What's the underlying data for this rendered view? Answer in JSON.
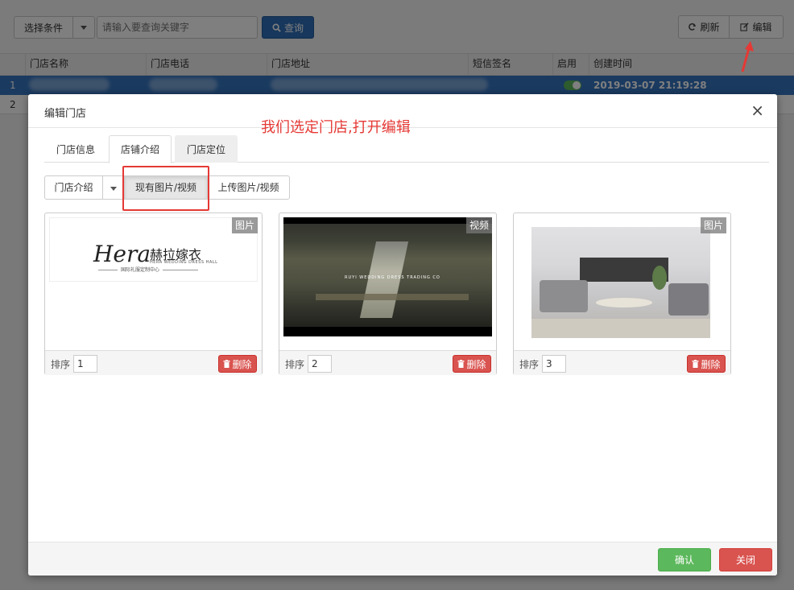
{
  "toolbar": {
    "condition_label": "选择条件",
    "search_placeholder": "请输入要查询关键字",
    "query_label": "查询",
    "refresh_label": "刷新",
    "edit_label": "编辑"
  },
  "table": {
    "columns": [
      "门店名称",
      "门店电话",
      "门店地址",
      "短信签名",
      "启用",
      "创建时间"
    ],
    "rows": [
      {
        "index": "1",
        "created": "2019-03-07 21:19:28",
        "enabled": true
      },
      {
        "index": "2"
      }
    ]
  },
  "modal": {
    "title": "编辑门店",
    "close_glyph": "×",
    "annotation": "我们选定门店,打开编辑",
    "tabs": [
      "门店信息",
      "店铺介绍",
      "门店定位"
    ],
    "active_tab": 1,
    "segments": {
      "intro_label": "门店介绍",
      "existing_label": "现有图片/视频",
      "upload_label": "上传图片/视频"
    },
    "cards": [
      {
        "badge": "图片",
        "sort_label": "排序",
        "sort_value": "1",
        "delete_label": "删除",
        "logo_script": "Hera",
        "logo_cn": "赫拉嫁衣",
        "logo_en": "HERA WEDDING DRESS HALL",
        "logo_sub": "国际礼服定制中心"
      },
      {
        "badge": "视频",
        "sort_label": "排序",
        "sort_value": "2",
        "delete_label": "删除",
        "video_caption": "RUYI WEDDING DRESS TRADING CO"
      },
      {
        "badge": "图片",
        "sort_label": "排序",
        "sort_value": "3",
        "delete_label": "删除"
      }
    ],
    "footer": {
      "ok_label": "确认",
      "close_label": "关闭"
    }
  },
  "colors": {
    "primary": "#2f6fb8",
    "selected_row": "#3474c0",
    "success": "#5cb85c",
    "danger": "#d9534f",
    "annotation": "#e53935"
  }
}
